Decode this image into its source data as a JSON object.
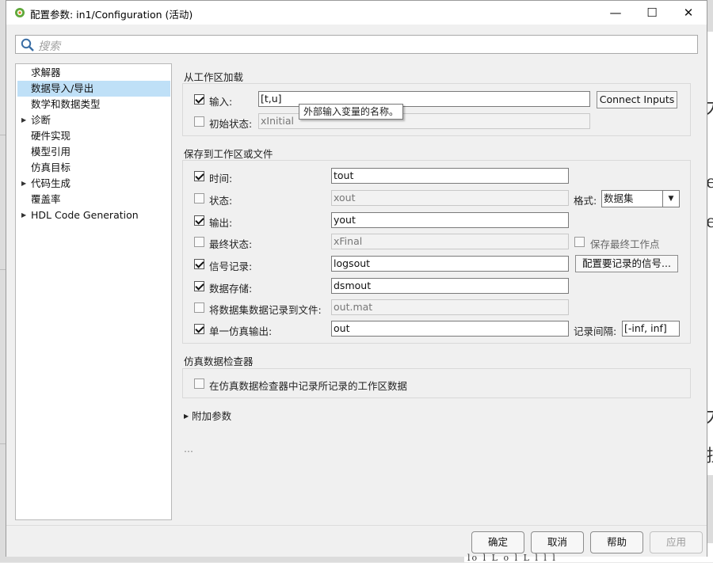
{
  "window": {
    "title": "配置参数: in1/Configuration (活动)",
    "minimize": "—",
    "maximize": "☐",
    "close": "✕"
  },
  "search": {
    "placeholder": "搜索"
  },
  "nav": {
    "items": [
      {
        "label": "求解器",
        "expandable": false,
        "selected": false
      },
      {
        "label": "数据导入/导出",
        "expandable": false,
        "selected": true
      },
      {
        "label": "数学和数据类型",
        "expandable": false,
        "selected": false
      },
      {
        "label": "诊断",
        "expandable": true,
        "selected": false
      },
      {
        "label": "硬件实现",
        "expandable": false,
        "selected": false
      },
      {
        "label": "模型引用",
        "expandable": false,
        "selected": false
      },
      {
        "label": "仿真目标",
        "expandable": false,
        "selected": false
      },
      {
        "label": "代码生成",
        "expandable": true,
        "selected": false
      },
      {
        "label": "覆盖率",
        "expandable": false,
        "selected": false
      },
      {
        "label": "HDL Code Generation",
        "expandable": true,
        "selected": false
      }
    ]
  },
  "load": {
    "title": "从工作区加载",
    "input": {
      "label": "输入:",
      "checked": true,
      "value": "[t,u]"
    },
    "connect_button": "Connect Inputs",
    "initial_state": {
      "label": "初始状态:",
      "checked": false,
      "value": "xInitial"
    },
    "tooltip": "外部输入变量的名称。"
  },
  "save": {
    "title": "保存到工作区或文件",
    "time": {
      "label": "时间:",
      "checked": true,
      "value": "tout"
    },
    "states": {
      "label": "状态:",
      "checked": false,
      "value": "xout"
    },
    "format_label": "格式:",
    "format_value": "数据集",
    "output": {
      "label": "输出:",
      "checked": true,
      "value": "yout"
    },
    "final_states": {
      "label": "最终状态:",
      "checked": false,
      "value": "xFinal"
    },
    "save_final_op": {
      "label": "保存最终工作点",
      "checked": false
    },
    "signal_logging": {
      "label": "信号记录:",
      "checked": true,
      "value": "logsout"
    },
    "config_signals_button": "配置要记录的信号...",
    "data_stores": {
      "label": "数据存储:",
      "checked": true,
      "value": "dsmout"
    },
    "log_dataset_file": {
      "label": "将数据集数据记录到文件:",
      "checked": false,
      "value": "out.mat"
    },
    "single_output": {
      "label": "单一仿真输出:",
      "checked": true,
      "value": "out"
    },
    "log_interval_label": "记录间隔:",
    "log_interval_value": "[-inf, inf]"
  },
  "sdi": {
    "title": "仿真数据检查器",
    "record": {
      "label": "在仿真数据检查器中记录所记录的工作区数据",
      "checked": false
    }
  },
  "additional": {
    "label": "附加参数"
  },
  "ellipsis": "...",
  "footer": {
    "ok": "确定",
    "cancel": "取消",
    "help": "帮助",
    "apply": "应用"
  },
  "background": {
    "doc_text": "lo l     L   o l L   l  l   l"
  },
  "colors": {
    "selection": "#bfe0f7",
    "window_bg": "#f0f0f0"
  }
}
